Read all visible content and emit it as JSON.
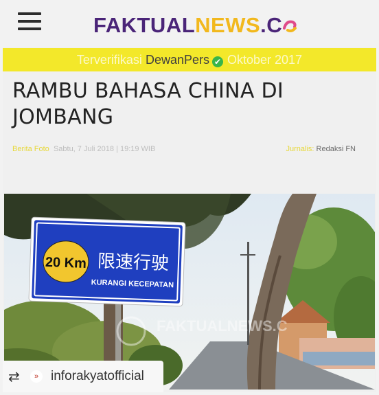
{
  "header": {
    "logo_part1": "FAKTUAL",
    "logo_part2": "NEWS",
    "logo_part3": ".C"
  },
  "banner": {
    "prefix": "Terverifikasi",
    "dewan": "Dewan",
    "pers": "Pers",
    "check_icon": "check-circle-icon",
    "suffix": "Oktober 2017"
  },
  "article": {
    "title": "RAMBU BAHASA CHINA DI JOMBANG",
    "category": "Berita Foto",
    "date": "Sabtu, 7 Juli 2018 | 19:19 WIB",
    "author_label": "Jurnalis:",
    "author": "Redaksi FN"
  },
  "photo": {
    "sign_speed": "20 Km",
    "sign_chinese": "限速行驶",
    "sign_text": "KURANGI KECEPATAN",
    "watermark": "FAKTUALNEWS.C"
  },
  "repost": {
    "icon": "repost-icon",
    "username": "inforakyatofficial"
  },
  "colors": {
    "brand_purple": "#4a2478",
    "brand_yellow": "#f2b81d",
    "banner_bg": "#f3e82a",
    "check_green": "#39b54a",
    "sign_blue": "#1f3fbf"
  }
}
